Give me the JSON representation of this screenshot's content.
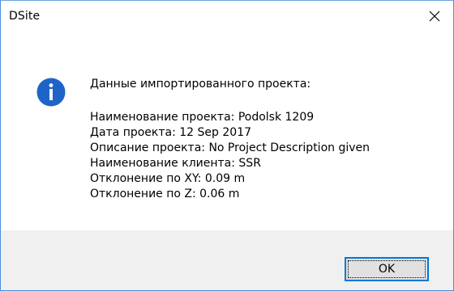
{
  "window": {
    "title": "DSite",
    "close_icon": "close-icon"
  },
  "dialog": {
    "icon": "info-icon",
    "heading": "Данные импортированного проекта:",
    "lines": [
      "Наименование проекта: Podolsk 1209",
      "Дата проекта: 12 Sep 2017",
      "Описание проекта: No Project Description given",
      "Наименование клиента: SSR",
      "Отклонение по XY: 0.09 m",
      "Отклонение по Z: 0.06 m"
    ]
  },
  "buttons": {
    "ok_label": "OK"
  },
  "colors": {
    "accent": "#0078d7",
    "icon_blue": "#1e64c8",
    "footer_bg": "#f0f0f0",
    "button_bg": "#e1e1e1"
  }
}
